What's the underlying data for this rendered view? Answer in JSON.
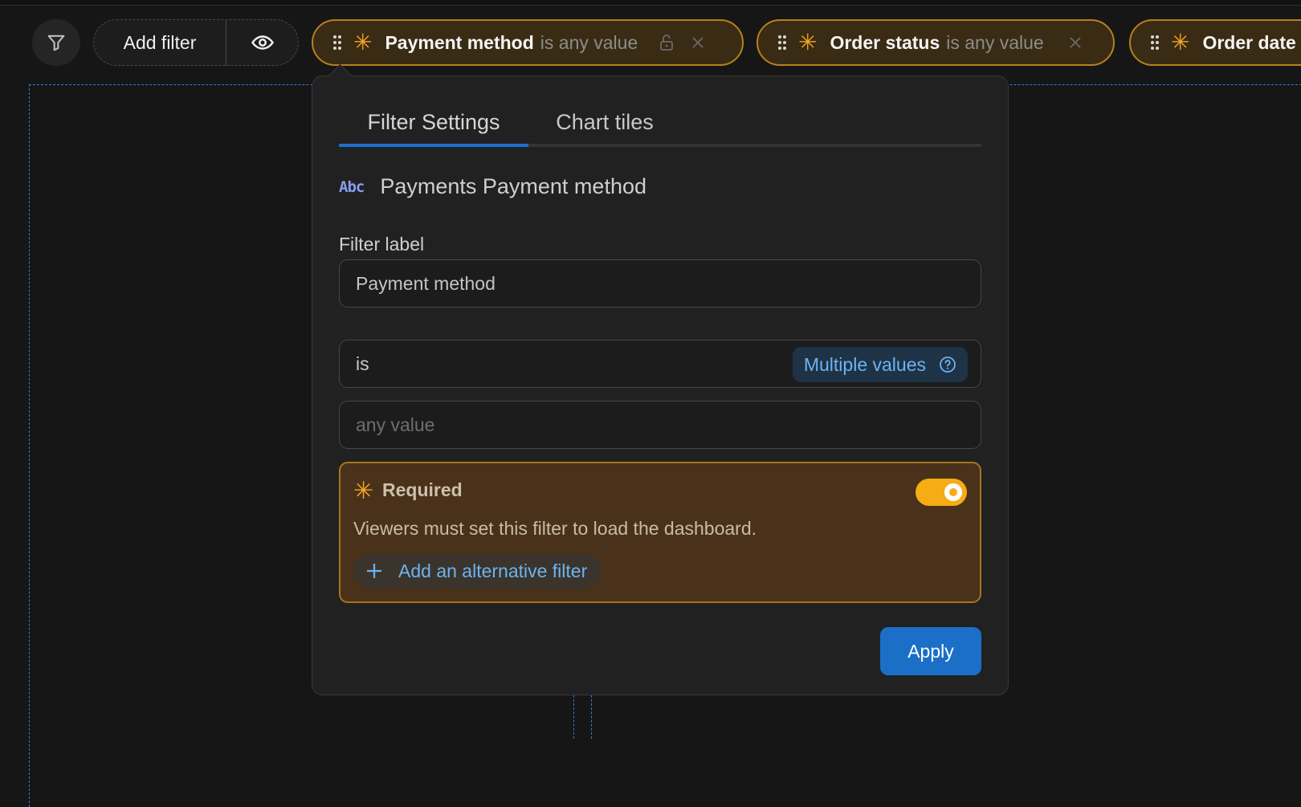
{
  "toolbar": {
    "add_filter_label": "Add filter",
    "chips": [
      {
        "label": "Payment method",
        "condition": "is any value",
        "locked": true
      },
      {
        "label": "Order status",
        "condition": "is any value"
      },
      {
        "label": "Order date",
        "condition": ""
      }
    ]
  },
  "popover": {
    "tabs": [
      "Filter Settings",
      "Chart tiles"
    ],
    "active_tab": "Filter Settings",
    "field_type_icon": "Abc",
    "field_name": "Payments Payment method",
    "filter_label_heading": "Filter label",
    "filter_label_value": "Payment method",
    "operator_value": "is",
    "multiple_values_label": "Multiple values",
    "value_placeholder": "any value",
    "required": {
      "title": "Required",
      "enabled": true,
      "description": "Viewers must set this filter to load the dashboard.",
      "add_alternative_label": "Add an alternative filter"
    },
    "apply_label": "Apply"
  },
  "colors": {
    "accent_blue": "#1b6fc7",
    "required_orange": "#f5a623",
    "chip_border": "#b8801c"
  }
}
